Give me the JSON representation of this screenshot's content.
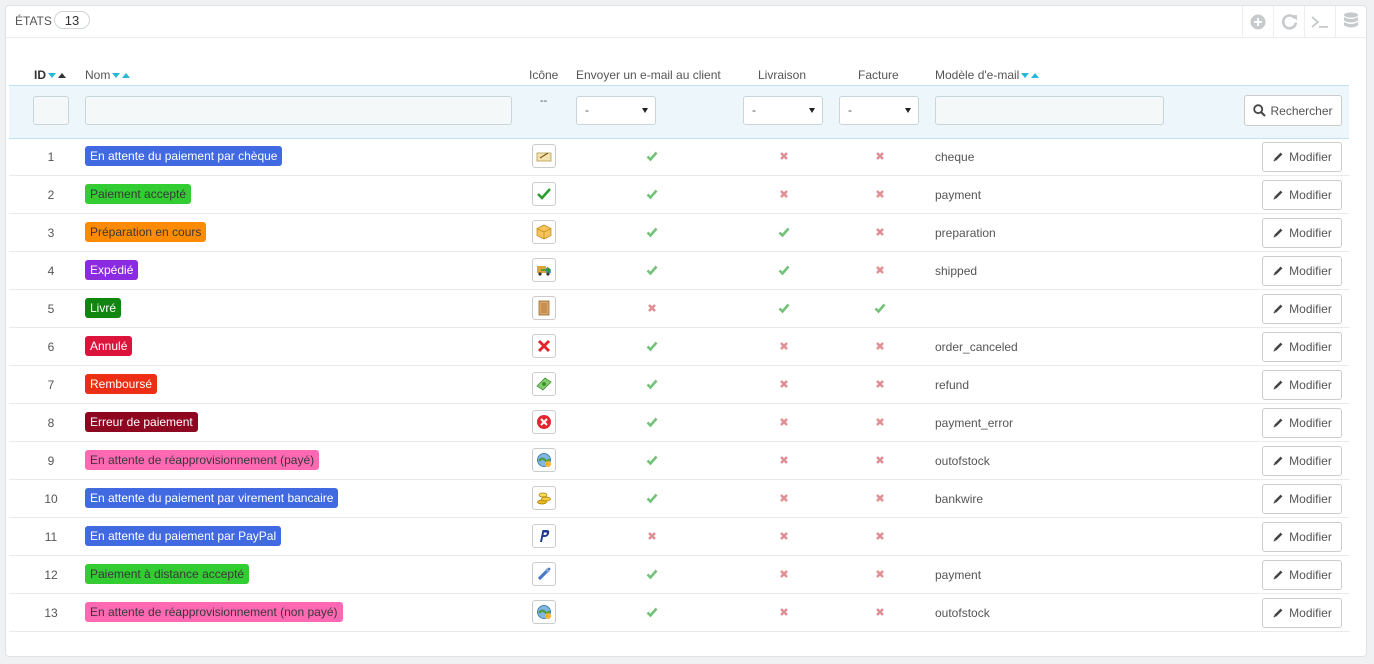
{
  "panel": {
    "title": "États",
    "count": "13",
    "toolbar": [
      {
        "icon": "add-icon"
      },
      {
        "icon": "refresh-icon"
      },
      {
        "icon": "sql-terminal-icon"
      },
      {
        "icon": "database-icon"
      }
    ]
  },
  "columns": {
    "id": "ID",
    "name": "Nom",
    "icon": "Icône",
    "send_email": "Envoyer un e-mail au client",
    "delivery": "Livraison",
    "invoice": "Facture",
    "template": "Modèle d'e-mail"
  },
  "filters": {
    "id_value": "",
    "name_value": "",
    "icon_placeholder": "--",
    "send_email_value": "-",
    "delivery_value": "-",
    "invoice_value": "-",
    "template_value": "",
    "search_label": "Rechercher"
  },
  "colors": {
    "check": "#72c279",
    "cross": "#e08f95",
    "accent": "#25b9d7"
  },
  "edit_label": "Modifier",
  "rows": [
    {
      "id": "1",
      "name": "En attente du paiement par chèque",
      "color": "#4169E1",
      "text": "#ffffff",
      "icon": "cheque-icon",
      "email": true,
      "delivery": false,
      "invoice": false,
      "template": "cheque"
    },
    {
      "id": "2",
      "name": "Paiement accepté",
      "color": "#32CD32",
      "text": "#383838",
      "icon": "check-icon",
      "email": true,
      "delivery": false,
      "invoice": false,
      "template": "payment"
    },
    {
      "id": "3",
      "name": "Préparation en cours",
      "color": "#FF8C00",
      "text": "#383838",
      "icon": "package-icon",
      "email": true,
      "delivery": true,
      "invoice": false,
      "template": "preparation"
    },
    {
      "id": "4",
      "name": "Expédié",
      "color": "#8A2BE2",
      "text": "#ffffff",
      "icon": "truck-icon",
      "email": true,
      "delivery": true,
      "invoice": false,
      "template": "shipped"
    },
    {
      "id": "5",
      "name": "Livré",
      "color": "#108510",
      "text": "#ffffff",
      "icon": "delivered-box-icon",
      "email": false,
      "delivery": true,
      "invoice": true,
      "template": ""
    },
    {
      "id": "6",
      "name": "Annulé",
      "color": "#DC143C",
      "text": "#ffffff",
      "icon": "cross-icon",
      "email": true,
      "delivery": false,
      "invoice": false,
      "template": "order_canceled"
    },
    {
      "id": "7",
      "name": "Remboursé",
      "color": "#ec2e15",
      "text": "#ffffff",
      "icon": "money-icon",
      "email": true,
      "delivery": false,
      "invoice": false,
      "template": "refund"
    },
    {
      "id": "8",
      "name": "Erreur de paiement",
      "color": "#8f0621",
      "text": "#ffffff",
      "icon": "error-icon",
      "email": true,
      "delivery": false,
      "invoice": false,
      "template": "payment_error"
    },
    {
      "id": "9",
      "name": "En attente de réapprovisionnement (payé)",
      "color": "#FF69B4",
      "text": "#383838",
      "icon": "restock-icon",
      "email": true,
      "delivery": false,
      "invoice": false,
      "template": "outofstock"
    },
    {
      "id": "10",
      "name": "En attente du paiement par virement bancaire",
      "color": "#4169E1",
      "text": "#ffffff",
      "icon": "coins-icon",
      "email": true,
      "delivery": false,
      "invoice": false,
      "template": "bankwire"
    },
    {
      "id": "11",
      "name": "En attente du paiement par PayPal",
      "color": "#4169E1",
      "text": "#ffffff",
      "icon": "paypal-icon",
      "email": false,
      "delivery": false,
      "invoice": false,
      "template": ""
    },
    {
      "id": "12",
      "name": "Paiement à distance accepté",
      "color": "#32CD32",
      "text": "#383838",
      "icon": "remote-payment-icon",
      "email": true,
      "delivery": false,
      "invoice": false,
      "template": "payment"
    },
    {
      "id": "13",
      "name": "En attente de réapprovisionnement (non payé)",
      "color": "#FF69B4",
      "text": "#383838",
      "icon": "restock-icon",
      "email": true,
      "delivery": false,
      "invoice": false,
      "template": "outofstock"
    }
  ]
}
